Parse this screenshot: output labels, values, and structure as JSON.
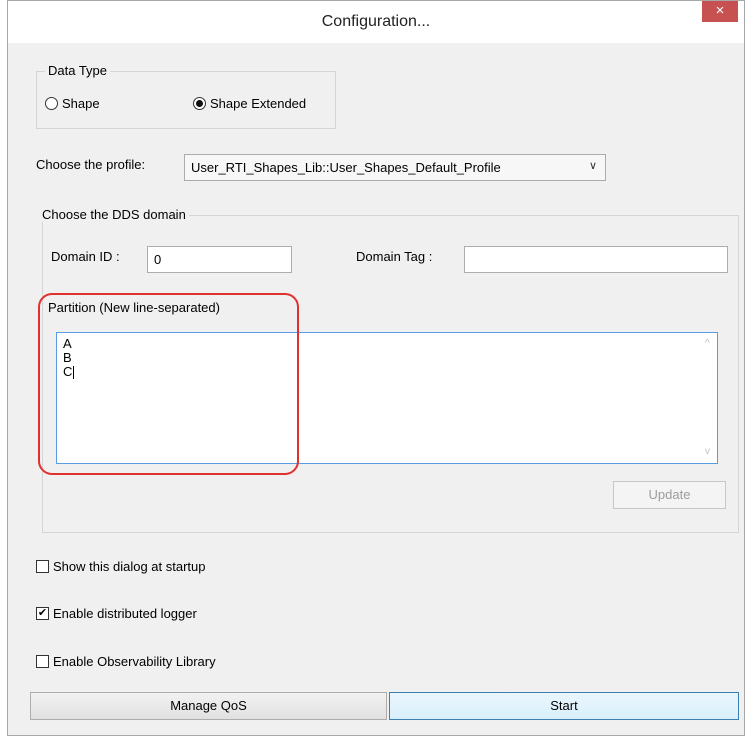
{
  "window": {
    "title": "Configuration...",
    "close_glyph": "×"
  },
  "data_type": {
    "legend": "Data Type",
    "options": [
      {
        "label": "Shape",
        "selected": false
      },
      {
        "label": "Shape Extended",
        "selected": true
      }
    ]
  },
  "profile": {
    "label": "Choose the profile:",
    "selected": "User_RTI_Shapes_Lib::User_Shapes_Default_Profile",
    "chevron": "∨"
  },
  "domain": {
    "legend": "Choose the DDS domain",
    "id_label": "Domain ID :",
    "id_value": "0",
    "tag_label": "Domain Tag :",
    "tag_value": ""
  },
  "partition": {
    "legend": "Partition (New line-separated)",
    "lines": [
      "A",
      "B",
      "C"
    ],
    "scroll_up": "^",
    "scroll_down": "v",
    "update_label": "Update"
  },
  "options": {
    "show_dialog": {
      "label": "Show this dialog at startup",
      "checked": false
    },
    "enable_logger": {
      "label": "Enable distributed logger",
      "checked": true
    },
    "enable_observability": {
      "label": "Enable Observability Library",
      "checked": false
    }
  },
  "buttons": {
    "manage_qos": "Manage QoS",
    "start": "Start"
  },
  "check_glyph": "✔",
  "colors": {
    "annotation": "#e03030",
    "close": "#c75050",
    "accent": "#569de5"
  }
}
